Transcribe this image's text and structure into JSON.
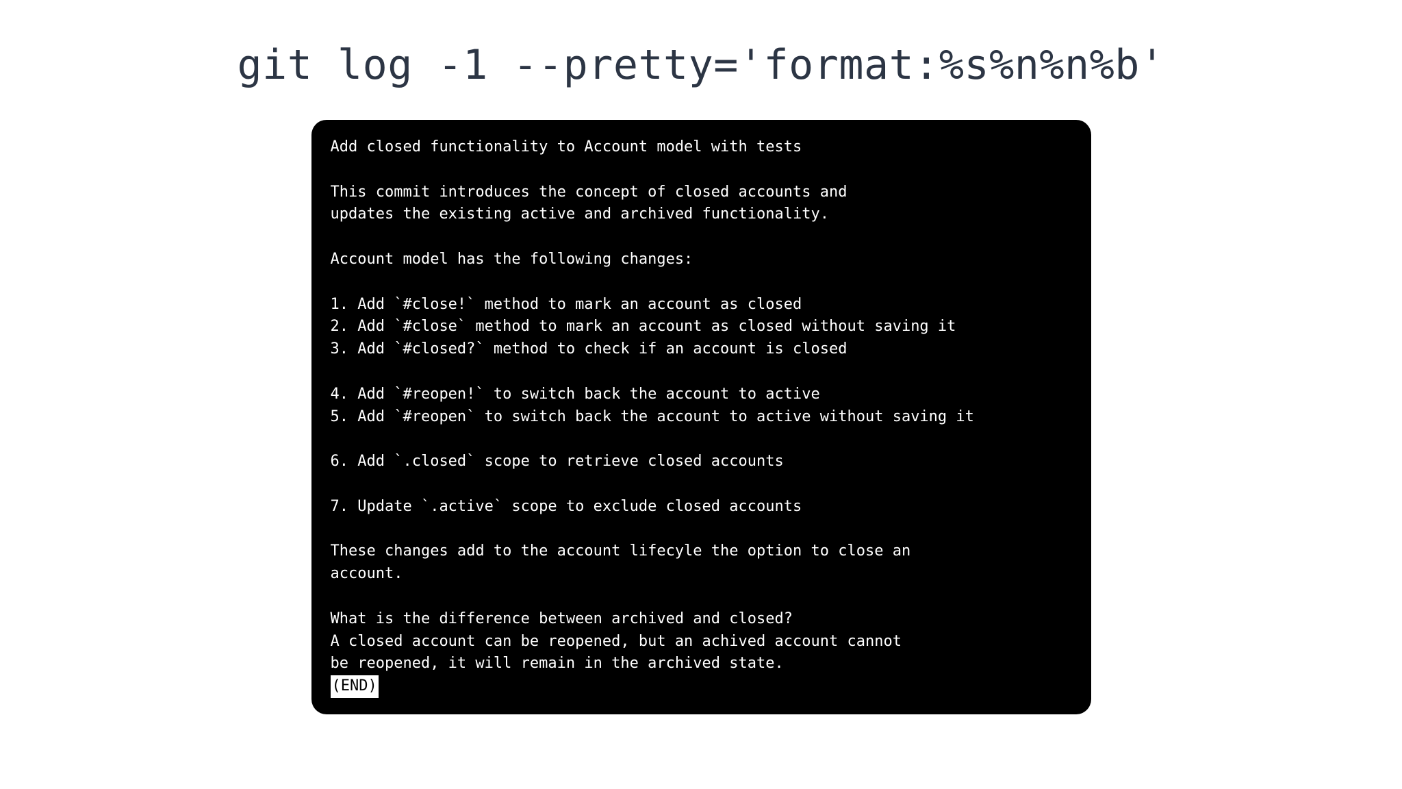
{
  "command": "git log -1 --pretty='format:%s%n%n%b'",
  "terminal": {
    "subject": "Add closed functionality to Account model with tests",
    "intro1": "This commit introduces the concept of closed accounts and",
    "intro2": "updates the existing active and archived functionality.",
    "heading": "Account model has the following changes:",
    "item1": "1. Add `#close!` method to mark an account as closed",
    "item2": "2. Add `#close` method to mark an account as closed without saving it",
    "item3": "3. Add `#closed?` method to check if an account is closed",
    "item4": "4. Add `#reopen!` to switch back the account to active",
    "item5": "5. Add `#reopen` to switch back the account to active without saving it",
    "item6": "6. Add `.closed` scope to retrieve closed accounts",
    "item7": "7. Update `.active` scope to exclude closed accounts",
    "summary1": "These changes add to the account lifecyle the option to close an",
    "summary2": "account.",
    "question": "What is the difference between archived and closed?",
    "answer1": "A closed account can be reopened, but an achived account cannot",
    "answer2": "be reopened, it will remain in the archived state.",
    "end": "(END)"
  }
}
